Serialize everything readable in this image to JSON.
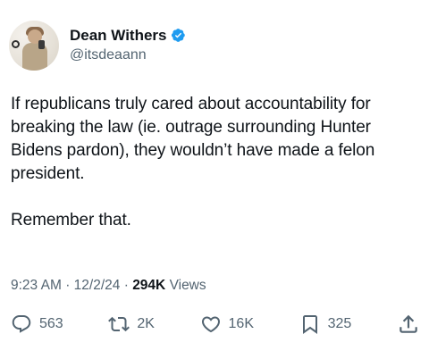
{
  "user": {
    "display_name": "Dean Withers",
    "handle": "@itsdeaann",
    "verified": true
  },
  "tweet": {
    "text": "If republicans truly cared about accountability for\nbreaking the law (ie. outrage surrounding Hunter\nBidens pardon), they wouldn’t have made a felon\npresident.\n\nRemember that."
  },
  "meta": {
    "time": "9:23 AM",
    "separator": "·",
    "date": "12/2/24",
    "views_count": "294K",
    "views_label": "Views"
  },
  "actions": {
    "replies": "563",
    "reposts": "2K",
    "likes": "16K",
    "bookmarks": "325"
  },
  "colors": {
    "verified_blue": "#1d9bf0",
    "secondary_text": "#536471",
    "primary_text": "#0f1419"
  },
  "icons": {
    "verified": "verified-badge-icon",
    "reply": "reply-icon",
    "repost": "repost-icon",
    "like": "heart-icon",
    "bookmark": "bookmark-icon",
    "share": "share-icon"
  }
}
